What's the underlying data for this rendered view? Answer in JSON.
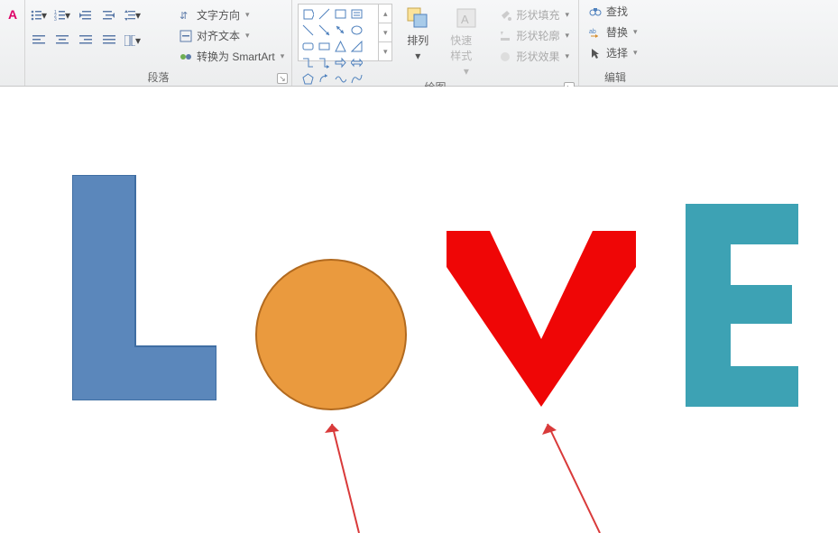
{
  "ribbon": {
    "groups": {
      "paragraph": {
        "label": "段落"
      },
      "drawing": {
        "label": "绘图"
      },
      "editing": {
        "label": "编辑"
      }
    },
    "text_direction": "文字方向",
    "align_text": "对齐文本",
    "convert_smartart": "转换为 SmartArt",
    "arrange": "排列",
    "quick_styles": "快速样式",
    "shape_fill": "形状填充",
    "shape_outline": "形状轮廓",
    "shape_effects": "形状效果",
    "find": "查找",
    "replace": "替换",
    "select": "选择"
  },
  "icons": {
    "bullets": "bullets-icon",
    "numbering": "numbering-icon",
    "indent_dec": "decrease-indent-icon",
    "indent_inc": "increase-indent-icon",
    "line_spacing": "line-spacing-icon",
    "align_left": "align-left-icon",
    "align_center": "align-center-icon",
    "align_right": "align-right-icon",
    "justify": "justify-icon",
    "columns": "columns-icon",
    "text_direction": "text-direction-icon",
    "align_text": "align-text-icon",
    "smartart": "smartart-icon",
    "arrange": "arrange-icon",
    "quick_styles": "quick-styles-icon",
    "shape_fill": "bucket-icon",
    "shape_outline": "pencil-icon",
    "shape_effects": "effects-icon",
    "find": "binoculars-icon",
    "replace": "replace-icon",
    "select": "cursor-icon"
  },
  "shapes_gallery": [
    "flowchart-process",
    "line",
    "rectangle",
    "text-box",
    "line2",
    "line3",
    "arrow-down-right",
    "ellipse",
    "rounded-rect",
    "rectangle2",
    "triangle",
    "right-triangle",
    "connector-elbow",
    "connector-elbow2",
    "arrow-right",
    "arrow-double",
    "pentagon",
    "hexagon",
    "curve",
    "freeform",
    "more"
  ],
  "canvas": {
    "letters": [
      "L",
      "O",
      "V",
      "E"
    ],
    "colors": {
      "L": "#5b87bb",
      "O_fill": "#ea9a3e",
      "O_stroke": "#b26a1f",
      "V": "#ef0606",
      "E": "#3da2b4",
      "arrow": "#d93a3a"
    }
  },
  "font_group_hint": "A"
}
